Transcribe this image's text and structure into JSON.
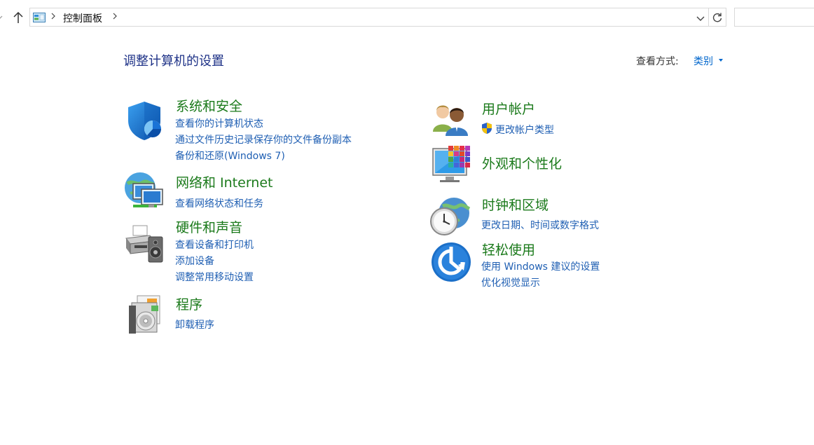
{
  "address_bar": {
    "breadcrumb": "控制面板"
  },
  "header": {
    "title": "调整计算机的设置",
    "view_by_label": "查看方式:",
    "view_by_value": "类别"
  },
  "categories_left": [
    {
      "title": "系统和安全",
      "icon": "shield-icon",
      "links": [
        "查看你的计算机状态",
        "通过文件历史记录保存你的文件备份副本",
        "备份和还原(Windows 7)"
      ]
    },
    {
      "title": "网络和 Internet",
      "icon": "network-icon",
      "links": [
        "查看网络状态和任务"
      ]
    },
    {
      "title": "硬件和声音",
      "icon": "printer-icon",
      "links": [
        "查看设备和打印机",
        "添加设备",
        "调整常用移动设置"
      ]
    },
    {
      "title": "程序",
      "icon": "programs-icon",
      "links": [
        "卸载程序"
      ]
    }
  ],
  "categories_right": [
    {
      "title": "用户帐户",
      "icon": "users-icon",
      "links": [
        "更改帐户类型"
      ]
    },
    {
      "title": "外观和个性化",
      "icon": "appearance-icon",
      "links": []
    },
    {
      "title": "时钟和区域",
      "icon": "clock-icon",
      "links": [
        "更改日期、时间或数字格式"
      ]
    },
    {
      "title": "轻松使用",
      "icon": "ease-of-access-icon",
      "links": [
        "使用 Windows 建议的设置",
        "优化视觉显示"
      ]
    }
  ],
  "colors": {
    "title_blue": "#1e3287",
    "category_green": "#1b7a1b",
    "link_blue": "#1f5fb3"
  }
}
